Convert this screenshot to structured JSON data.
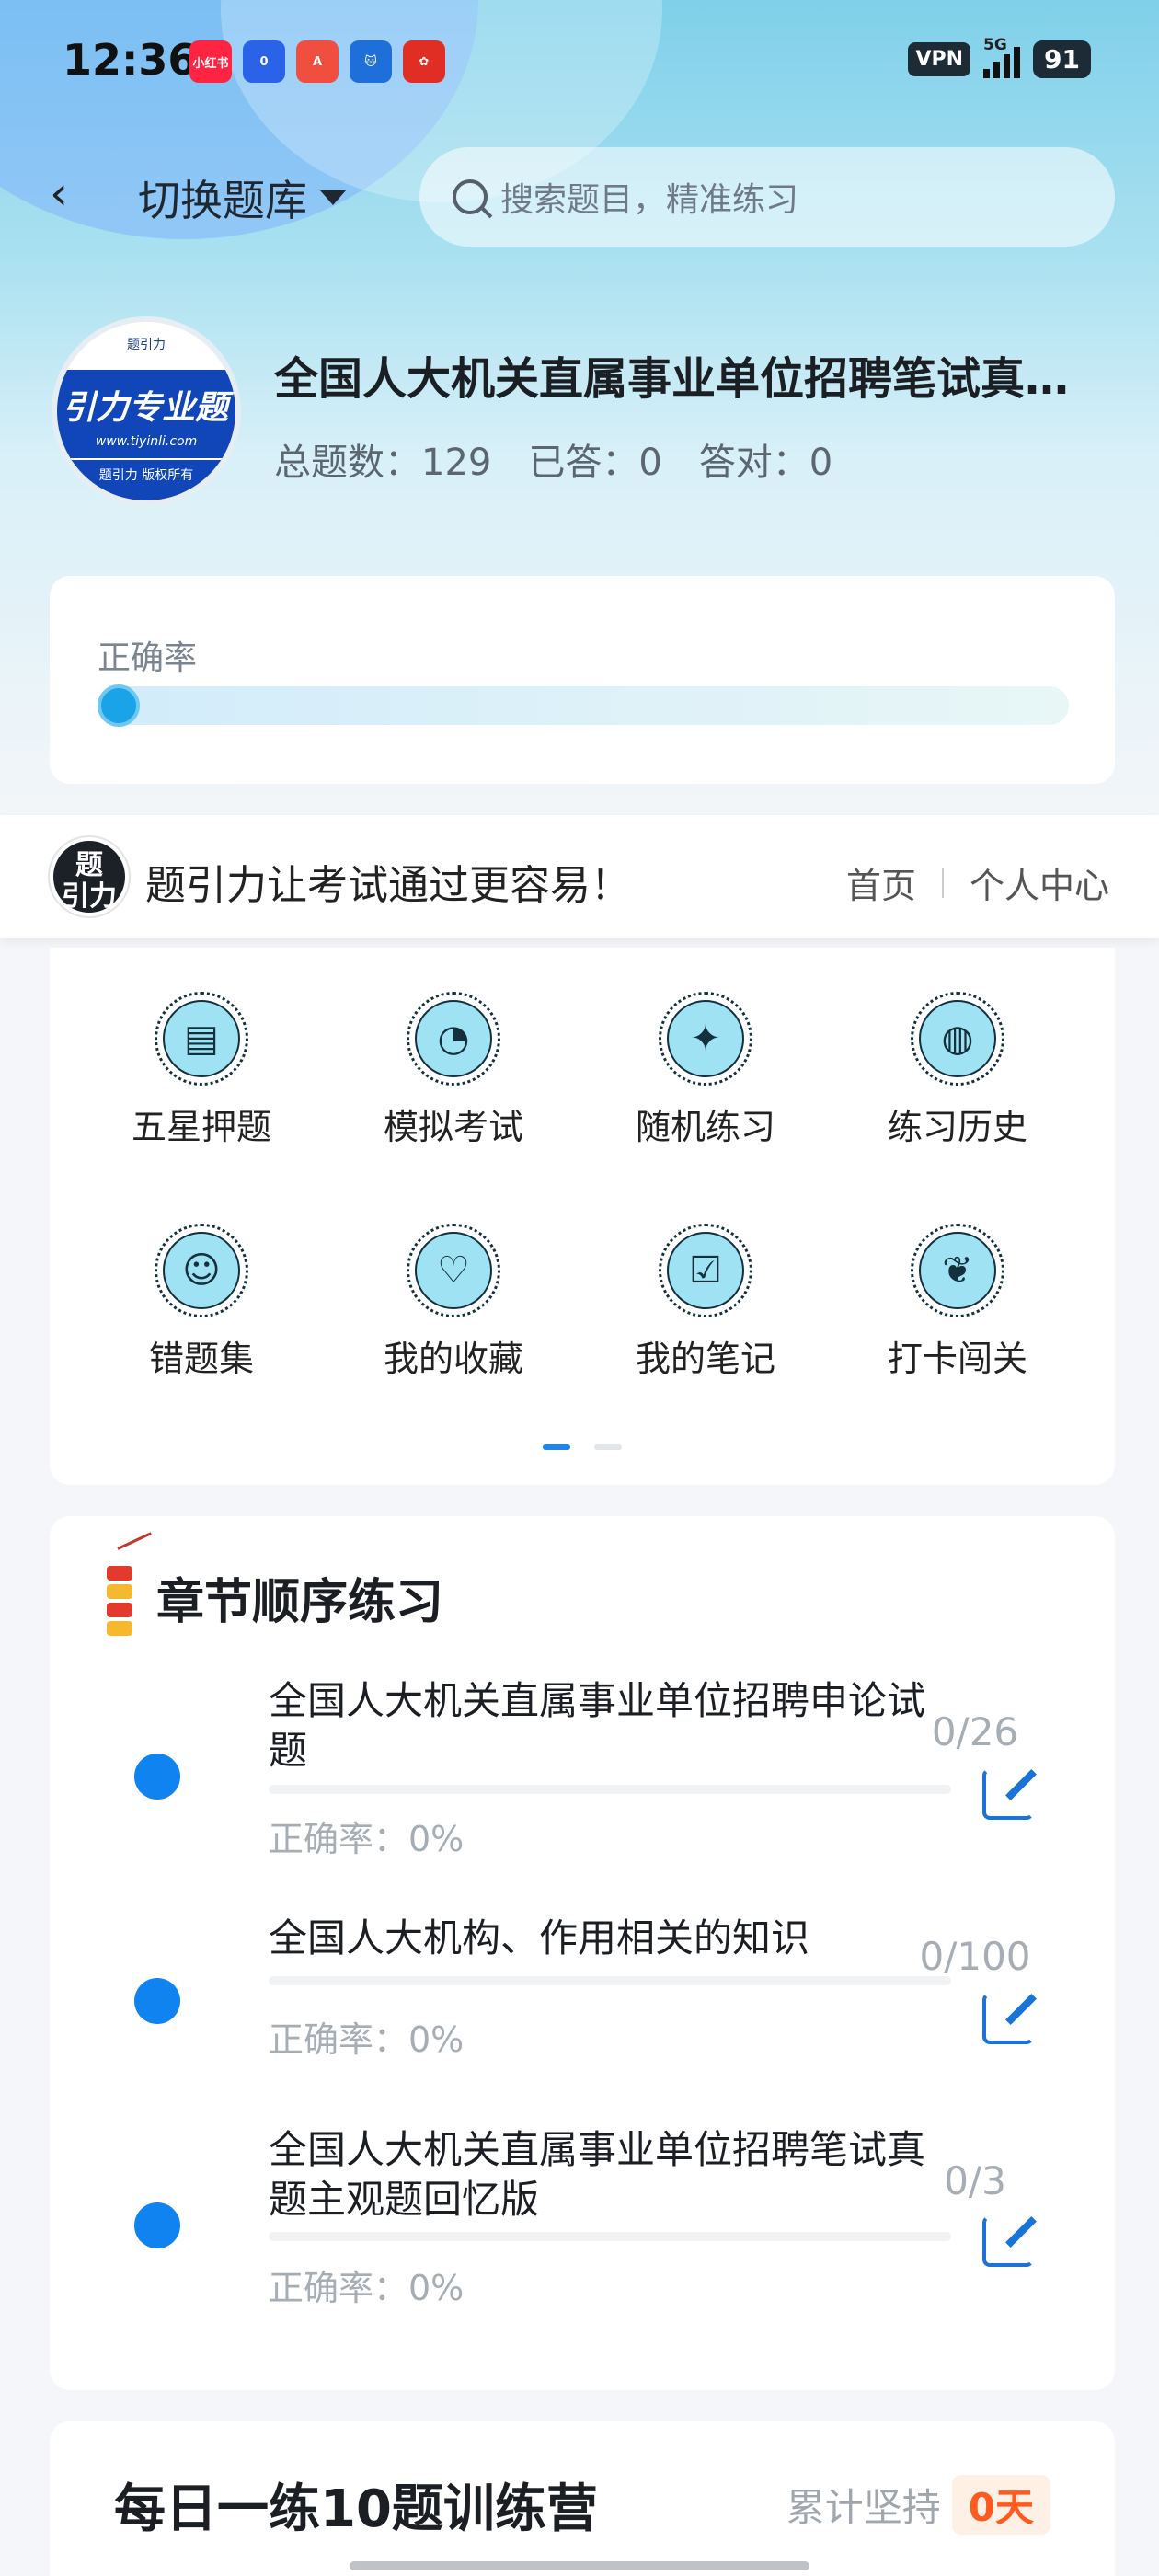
{
  "status_bar": {
    "time": "12:36",
    "vpn": "VPN",
    "network": "5G",
    "battery": "91",
    "apps": [
      {
        "icon": "xiaohongshu-icon",
        "text": "小红书",
        "color": "#ff2442"
      },
      {
        "icon": "taobao-icon",
        "text": "0",
        "color": "#2a62e8"
      },
      {
        "icon": "a-app-icon",
        "text": "A",
        "color": "#f04e3e"
      },
      {
        "icon": "cat-app-icon",
        "text": "",
        "color": "#1e6fd9"
      },
      {
        "icon": "pinduoduo-icon",
        "text": "",
        "color": "#e02e24"
      }
    ]
  },
  "nav": {
    "switch_bank": "切换题库",
    "search_placeholder": "搜索题目，精准练习"
  },
  "bank": {
    "logo_top": "题引力",
    "logo_big": "引力专业题",
    "logo_url": "www.tiyinli.com",
    "logo_bottom": "题引力 版权所有",
    "title": "全国人大机关直属事业单位招聘笔试真题主观题回忆版",
    "stats": {
      "total": "总题数：129",
      "answered": "已答：0",
      "correct": "答对：0"
    }
  },
  "accuracy": {
    "label": "正确率",
    "value": 0
  },
  "banner": {
    "logo_text": "题引力",
    "slogan": "题引力让考试通过更容易！",
    "links": [
      "首页",
      "个人中心"
    ]
  },
  "functions": [
    {
      "label": "五星押题",
      "icon": "id-card-icon"
    },
    {
      "label": "模拟考试",
      "icon": "gauge-icon"
    },
    {
      "label": "随机练习",
      "icon": "network-icon"
    },
    {
      "label": "练习历史",
      "icon": "globe-icon"
    },
    {
      "label": "错题集",
      "icon": "head-icon"
    },
    {
      "label": "我的收藏",
      "icon": "heart-icon"
    },
    {
      "label": "我的笔记",
      "icon": "checklist-icon"
    },
    {
      "label": "打卡闯关",
      "icon": "sprout-icon"
    }
  ],
  "chapters": {
    "title": "章节顺序练习",
    "items": [
      {
        "name": "全国人大机关直属事业单位招聘申论试题",
        "accuracy": "正确率：0%",
        "count": "0/26"
      },
      {
        "name": "全国人大机构、作用相关的知识",
        "accuracy": "正确率：0%",
        "count": "0/100"
      },
      {
        "name": "全国人大机关直属事业单位招聘笔试真题主观题回忆版",
        "accuracy": "正确率：0%",
        "count": "0/3"
      }
    ]
  },
  "daily": {
    "title": "每日一练10题训练营",
    "streak_label": "累计坚持",
    "streak_value": "0天"
  },
  "colors": {
    "accent": "#0f84f0",
    "edit": "#1a74d8",
    "streak": "#ff5a1f"
  }
}
